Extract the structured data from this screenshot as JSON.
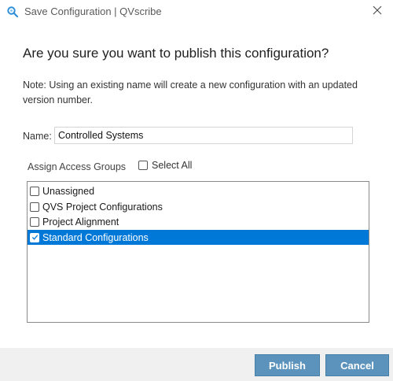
{
  "window": {
    "title": "Save Configuration | QVscribe",
    "close_icon": "close-icon",
    "app_icon": "qvscribe-logo-icon"
  },
  "dialog": {
    "heading": "Are you sure you want to publish this configuration?",
    "note": "Note: Using an existing name will create a new configuration with an updated version number.",
    "name_label": "Name:",
    "name_value": "Controlled Systems",
    "groups_label": "Assign Access Groups",
    "select_all_label": "Select All",
    "select_all_checked": false,
    "access_groups": [
      {
        "label": "Unassigned",
        "checked": false,
        "selected": false
      },
      {
        "label": "QVS Project Configurations",
        "checked": false,
        "selected": false
      },
      {
        "label": "Project Alignment",
        "checked": false,
        "selected": false
      },
      {
        "label": "Standard Configurations",
        "checked": true,
        "selected": true
      }
    ]
  },
  "footer": {
    "publish_label": "Publish",
    "cancel_label": "Cancel"
  },
  "colors": {
    "accent_button": "#5b93bd",
    "selection": "#0078d7",
    "footer_bg": "#f0f0f0"
  }
}
